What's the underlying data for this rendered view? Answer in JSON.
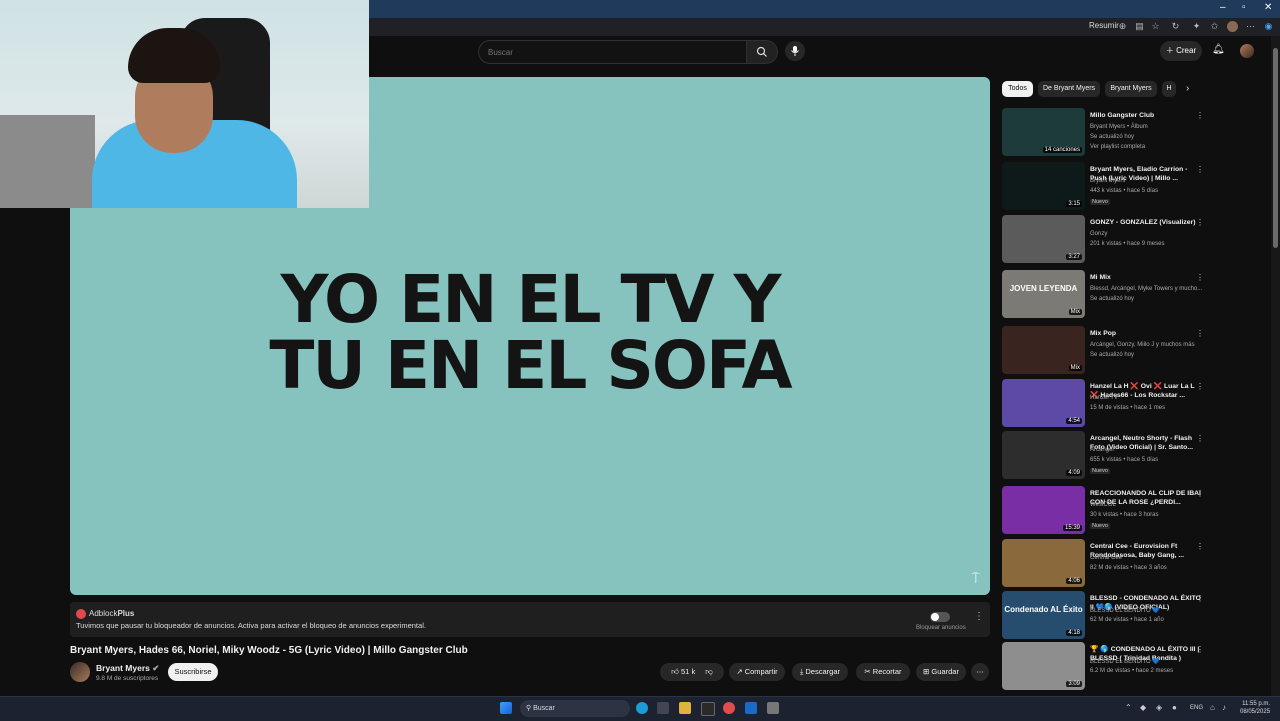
{
  "browser": {
    "summarize_label": "Resumir"
  },
  "header": {
    "search_placeholder": "Buscar",
    "create_label": "Crear"
  },
  "video": {
    "lyric_line1": "YO EN EL TV Y",
    "lyric_line2": "TU EN EL SOFA",
    "title": "Bryant Myers, Hades 66, Noriel, Miky Woodz - 5G (Lyric Video) | Millo Gangster Club",
    "channel": "Bryant Myers",
    "subscribers": "9.8 M de suscriptores",
    "subscribe_label": "Suscribirse",
    "likes": "51 k",
    "share_label": "Compartir",
    "download_label": "Descargar",
    "clip_label": "Recortar",
    "save_label": "Guardar"
  },
  "adblock": {
    "brand_prefix": "Adblock",
    "brand_suffix": "Plus",
    "message": "Tuvimos que pausar tu bloqueador de anuncios. Activa para activar el bloqueo de anuncios experimental.",
    "toggle_label": "Bloquear anuncios"
  },
  "chips": [
    "Todos",
    "De Bryant Myers",
    "Bryant Myers",
    "H"
  ],
  "sidebar": [
    {
      "title": "Millo Gangster Club",
      "channel": "Bryant Myers • Álbum",
      "meta": "Se actualizó hoy",
      "extra": "Ver playlist completa",
      "overlay": "14 canciones",
      "color": "#1d3b3a"
    },
    {
      "title": "Bryant Myers, Eladio Carrion - Push (Lyric Video) | Millo ...",
      "channel": "Bryant Myers",
      "meta": "443 k vistas • hace 5 días",
      "badge": "Nuevo",
      "duration": "3:15",
      "color": "#0e1a1a"
    },
    {
      "title": "GONZY - GONZALEZ (Visualizer)",
      "channel": "Gonzy",
      "meta": "201 k vistas • hace 9 meses",
      "duration": "3:27",
      "color": "#5b5b5b"
    },
    {
      "title": "Mi Mix",
      "channel": "Blessd, Arcángel, Myke Towers y mucho...",
      "meta": "Se actualizó hoy",
      "duration": "Mix",
      "color": "#7c7a74",
      "thumb_text": "JOVEN LEYENDA"
    },
    {
      "title": "Mix Pop",
      "channel": "Arcángel, Gonzy, Miilo J y muchos más",
      "meta": "Se actualizó hoy",
      "duration": "Mix",
      "color": "#3a2420"
    },
    {
      "title": "Hanzel La H ❌ Ovi ❌ Luar La L ❌ Hades66 - Los Rockstar ...",
      "channel": "Hanzel TV",
      "meta": "15 M de vistas • hace 1 mes",
      "duration": "4:54",
      "color": "#5d4aa6"
    },
    {
      "title": "Arcangel, Neutro Shorty - Flash Foto (Video Oficial) | Sr. Santo...",
      "channel": "Arcangel",
      "meta": "655 k vistas • hace 5 días",
      "badge": "Nuevo",
      "duration": "4:09",
      "color": "#2d2d2d"
    },
    {
      "title": "REACCIONANDO AL CLIP DE IBAI CON DE LA ROSE ¿PERDI...",
      "channel": "WestCOL",
      "meta": "30 k vistas • hace 3 horas",
      "badge": "Nuevo",
      "duration": "15:39",
      "color": "#7a2ea6"
    },
    {
      "title": "Central Cee - Eurovision Ft Rondodasosa, Baby Gang, ...",
      "channel": "Central Cee",
      "meta": "82 M de vistas • hace 3 años",
      "duration": "4:06",
      "color": "#8a6a3c"
    },
    {
      "title": "BLESSD - CONDENADO AL ÉXITO II 💙🌎 (VIDEO OFICIAL)",
      "channel": "BLESSD EL BENDITO 💙",
      "meta": "62 M de vistas • hace 1 año",
      "duration": "4:18",
      "color": "#264d6e",
      "thumb_text": "Condenado AL Éxito"
    },
    {
      "title": "🏆 🌎 CONDENADO AL ÉXITO III | BLESSD ( Trinidad Bendita )",
      "channel": "BLESSD EL BENDITO 💙",
      "meta": "6.2 M de vistas • hace 2 meses",
      "duration": "3:09",
      "color": "#8e8e8e"
    }
  ],
  "taskbar": {
    "search_label": "Buscar",
    "lang": "ENG",
    "time": "11:55 p.m.",
    "date": "08/05/2025"
  }
}
